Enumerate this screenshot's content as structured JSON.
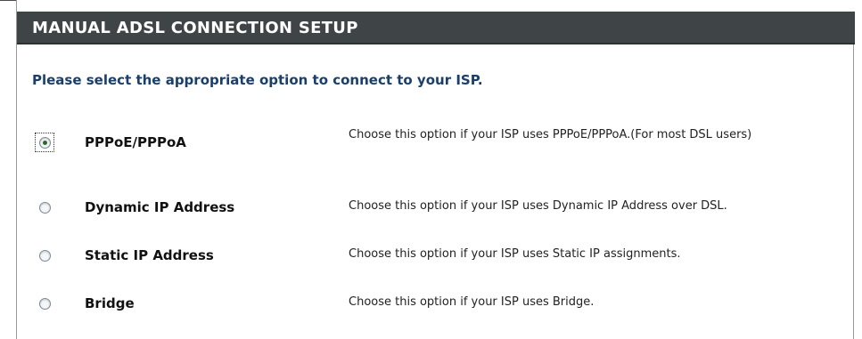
{
  "section": {
    "title": "MANUAL ADSL CONNECTION SETUP",
    "instruction": "Please select the appropriate option to connect to your ISP."
  },
  "options": [
    {
      "label": "PPPoE/PPPoA",
      "description": "Choose this option if your ISP uses PPPoE/PPPoA.(For most DSL users)",
      "selected": true
    },
    {
      "label": "Dynamic IP Address",
      "description": "Choose this option if your ISP uses Dynamic IP Address over DSL.",
      "selected": false
    },
    {
      "label": "Static IP Address",
      "description": "Choose this option if your ISP uses Static IP assignments.",
      "selected": false
    },
    {
      "label": "Bridge",
      "description": "Choose this option if your ISP uses Bridge.",
      "selected": false
    }
  ],
  "colors": {
    "header_bg": "#3f4446",
    "header_text": "#ffffff",
    "instruction_text": "#1a3f6b"
  }
}
